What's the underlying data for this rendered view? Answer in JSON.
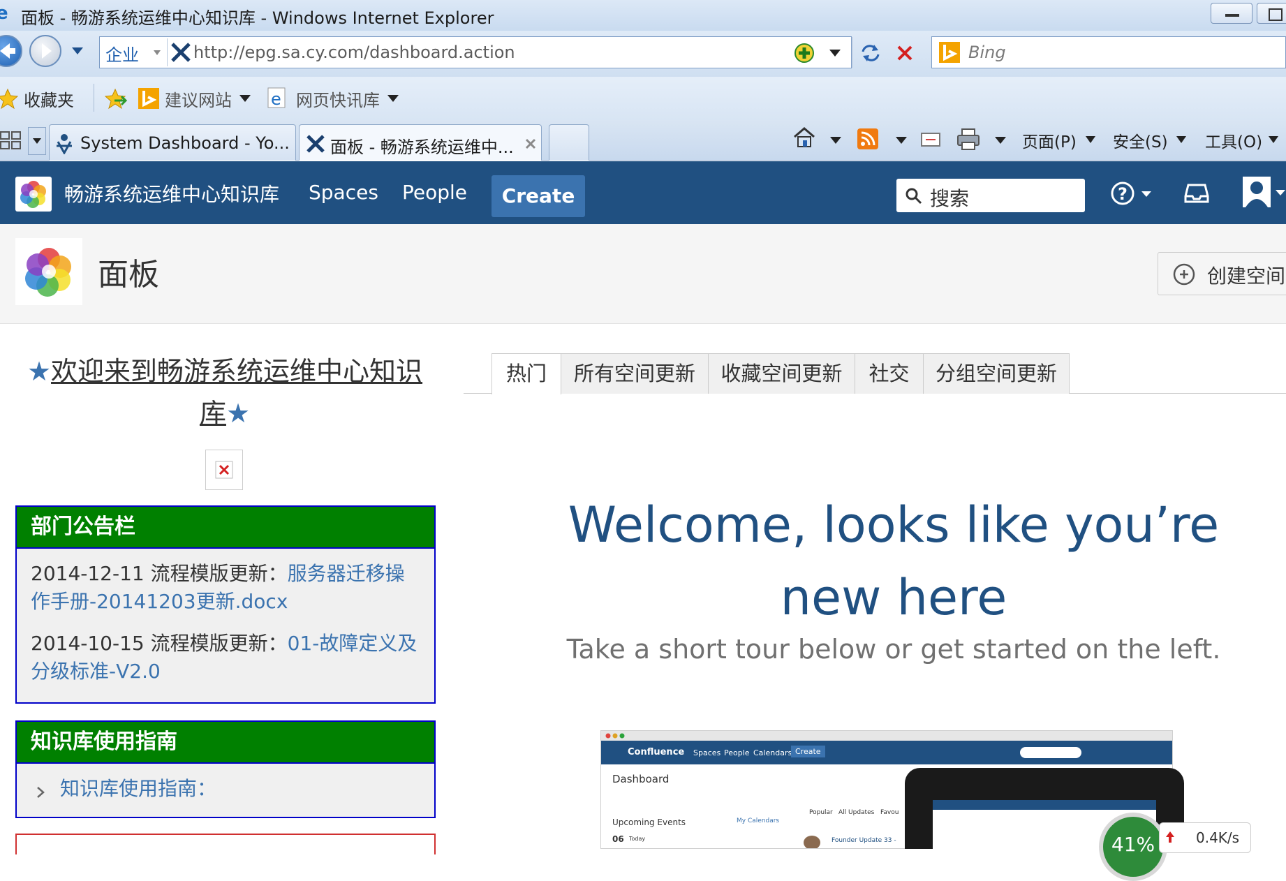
{
  "window": {
    "title": "面板 - 畅游系统运维中心知识库 - Windows Internet Explorer"
  },
  "navbar": {
    "zone_label": "企业",
    "url": "http://epg.sa.cy.com/dashboard.action",
    "search_placeholder": "Bing"
  },
  "favorites_bar": {
    "favorites_label": "收藏夹",
    "suggested_sites": "建议网站",
    "web_slice_gallery": "网页快讯库"
  },
  "tabs": [
    {
      "label": "System Dashboard - Yo..."
    },
    {
      "label": "面板 - 畅游系统运维中..."
    }
  ],
  "command_bar": {
    "page": "页面(P)",
    "safety": "安全(S)",
    "tools": "工具(O)"
  },
  "confluence_header": {
    "site_name": "畅游系统运维中心知识库",
    "nav": [
      "Spaces",
      "People"
    ],
    "create_label": "Create",
    "search_placeholder": "搜索"
  },
  "page_header": {
    "title": "面板",
    "create_space": "创建空间"
  },
  "welcome_heading": {
    "star": "★",
    "text": "欢迎来到畅游系统运维中心知识库"
  },
  "panels": {
    "notice": {
      "title": "部门公告栏",
      "items": [
        {
          "prefix": "2014-12-11 流程模版更新：",
          "link": "服务器迁移操作手册-20141203更新.docx"
        },
        {
          "prefix": "2014-10-15  流程模版更新：",
          "link": "01-故障定义及分级标准-V2.0"
        }
      ]
    },
    "guide": {
      "title": "知识库使用指南",
      "link": "知识库使用指南："
    }
  },
  "content_tabs": [
    "热门",
    "所有空间更新",
    "收藏空间更新",
    "社交",
    "分组空间更新"
  ],
  "welcome_message": {
    "title": "Welcome, looks like you’re new here",
    "subtitle": "Take a short tour below or get started on the left."
  },
  "tour_preview": {
    "brand": "Confluence",
    "nav": [
      "Spaces",
      "People",
      "Calendars"
    ],
    "create": "Create",
    "dashboard": "Dashboard",
    "upcoming": "Upcoming Events",
    "calendars": "My Calendars",
    "tabs": [
      "Popular",
      "All Updates",
      "Favou"
    ],
    "date": "06",
    "today": "Today",
    "update": "Founder Update 33 -"
  },
  "network_meter": {
    "percent": "41%",
    "speed": "0.4K/s"
  },
  "colors": {
    "confluence_blue": "#205081",
    "create_button": "#3b73af",
    "panel_header_green": "#008000",
    "panel_border": "#0000c8"
  }
}
